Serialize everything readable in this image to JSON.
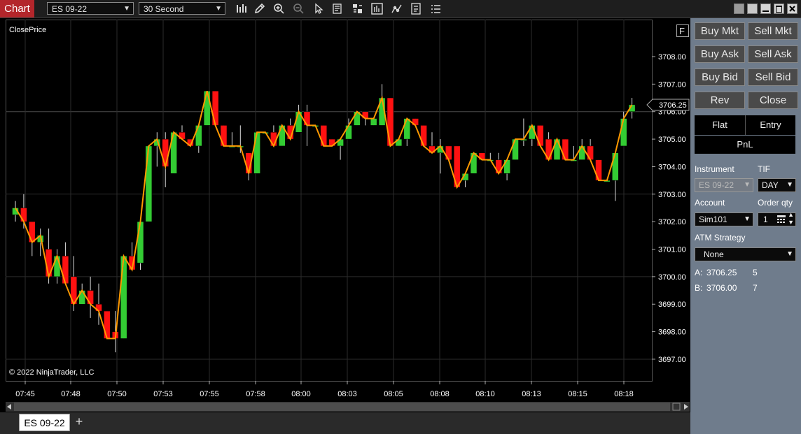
{
  "app": {
    "title": "Chart",
    "accent": "#b3262b"
  },
  "toolbar": {
    "instrument": "ES 09-22",
    "interval": "30 Second",
    "icons": [
      "bar-type-icon",
      "pencil-icon",
      "zoom-in-icon",
      "zoom-out-icon",
      "pointer-icon",
      "properties-icon",
      "data-box-icon",
      "indicators-icon",
      "strategies-icon",
      "chart-trader-icon",
      "more-icon"
    ]
  },
  "chart": {
    "plot_label": "ClosePrice",
    "f_button": "F",
    "copyright": "© 2022 NinjaTrader, LLC",
    "price_marker": "3706.25"
  },
  "chart_data": {
    "type": "candlestick",
    "x_ticks": [
      "07:45",
      "07:48",
      "07:50",
      "07:53",
      "07:55",
      "07:58",
      "08:00",
      "08:03",
      "08:05",
      "08:08",
      "08:10",
      "08:13",
      "08:15",
      "08:18"
    ],
    "y_ticks": [
      "3708.00",
      "3707.00",
      "3706.00",
      "3705.00",
      "3704.00",
      "3703.00",
      "3702.00",
      "3701.00",
      "3700.00",
      "3699.00",
      "3698.00",
      "3697.00"
    ],
    "ylim": [
      3696.7,
      3708.6
    ],
    "up_color": "#33cc33",
    "down_color": "#ff1111",
    "line_color": "#ff9900",
    "bars": [
      {
        "o": 3702.25,
        "h": 3702.75,
        "l": 3702.0,
        "c": 3702.5
      },
      {
        "o": 3702.5,
        "h": 3703.0,
        "l": 3701.75,
        "c": 3702.0
      },
      {
        "o": 3702.0,
        "h": 3702.0,
        "l": 3700.75,
        "c": 3701.25
      },
      {
        "o": 3701.25,
        "h": 3701.75,
        "l": 3700.75,
        "c": 3701.5
      },
      {
        "o": 3701.0,
        "h": 3701.75,
        "l": 3699.75,
        "c": 3700.0
      },
      {
        "o": 3700.0,
        "h": 3701.0,
        "l": 3699.75,
        "c": 3700.75
      },
      {
        "o": 3700.75,
        "h": 3701.25,
        "l": 3699.75,
        "c": 3699.75
      },
      {
        "o": 3700.0,
        "h": 3700.75,
        "l": 3698.75,
        "c": 3699.0
      },
      {
        "o": 3699.0,
        "h": 3699.75,
        "l": 3699.0,
        "c": 3699.5
      },
      {
        "o": 3699.5,
        "h": 3700.0,
        "l": 3698.5,
        "c": 3699.0
      },
      {
        "o": 3699.0,
        "h": 3699.75,
        "l": 3698.25,
        "c": 3698.75
      },
      {
        "o": 3698.75,
        "h": 3698.75,
        "l": 3697.75,
        "c": 3697.75
      },
      {
        "o": 3698.0,
        "h": 3698.75,
        "l": 3697.25,
        "c": 3697.75
      },
      {
        "o": 3697.75,
        "h": 3700.75,
        "l": 3697.75,
        "c": 3700.75
      },
      {
        "o": 3700.75,
        "h": 3701.25,
        "l": 3700.25,
        "c": 3700.25
      },
      {
        "o": 3700.5,
        "h": 3701.25,
        "l": 3700.25,
        "c": 3702.0
      },
      {
        "o": 3702.0,
        "h": 3704.75,
        "l": 3702.0,
        "c": 3704.75
      },
      {
        "o": 3704.75,
        "h": 3705.25,
        "l": 3704.0,
        "c": 3705.0
      },
      {
        "o": 3705.0,
        "h": 3705.25,
        "l": 3703.25,
        "c": 3704.0
      },
      {
        "o": 3703.75,
        "h": 3705.25,
        "l": 3703.75,
        "c": 3705.25
      },
      {
        "o": 3705.25,
        "h": 3705.5,
        "l": 3705.0,
        "c": 3705.0
      },
      {
        "o": 3705.0,
        "h": 3705.0,
        "l": 3704.75,
        "c": 3704.75
      },
      {
        "o": 3704.75,
        "h": 3705.5,
        "l": 3704.5,
        "c": 3705.5
      },
      {
        "o": 3705.5,
        "h": 3706.75,
        "l": 3705.5,
        "c": 3706.75
      },
      {
        "o": 3706.75,
        "h": 3706.75,
        "l": 3705.5,
        "c": 3705.5
      },
      {
        "o": 3705.5,
        "h": 3705.5,
        "l": 3704.75,
        "c": 3704.75
      },
      {
        "o": 3704.75,
        "h": 3705.25,
        "l": 3704.75,
        "c": 3704.75
      },
      {
        "o": 3704.75,
        "h": 3705.5,
        "l": 3704.5,
        "c": 3704.75
      },
      {
        "o": 3704.5,
        "h": 3704.5,
        "l": 3703.5,
        "c": 3703.75
      },
      {
        "o": 3703.75,
        "h": 3705.25,
        "l": 3703.75,
        "c": 3705.25
      },
      {
        "o": 3705.25,
        "h": 3705.25,
        "l": 3705.25,
        "c": 3705.25
      },
      {
        "o": 3705.25,
        "h": 3705.5,
        "l": 3704.75,
        "c": 3704.75
      },
      {
        "o": 3704.75,
        "h": 3705.5,
        "l": 3704.75,
        "c": 3705.5
      },
      {
        "o": 3705.5,
        "h": 3705.75,
        "l": 3705.0,
        "c": 3705.0
      },
      {
        "o": 3705.25,
        "h": 3706.25,
        "l": 3705.25,
        "c": 3706.0
      },
      {
        "o": 3706.0,
        "h": 3706.25,
        "l": 3704.75,
        "c": 3705.5
      },
      {
        "o": 3705.5,
        "h": 3705.5,
        "l": 3705.5,
        "c": 3705.5
      },
      {
        "o": 3705.5,
        "h": 3705.5,
        "l": 3704.75,
        "c": 3704.75
      },
      {
        "o": 3705.0,
        "h": 3705.0,
        "l": 3704.75,
        "c": 3704.75
      },
      {
        "o": 3704.75,
        "h": 3705.0,
        "l": 3704.25,
        "c": 3705.0
      },
      {
        "o": 3705.0,
        "h": 3705.75,
        "l": 3705.0,
        "c": 3705.5
      },
      {
        "o": 3705.5,
        "h": 3705.75,
        "l": 3705.5,
        "c": 3706.0
      },
      {
        "o": 3706.0,
        "h": 3706.0,
        "l": 3705.5,
        "c": 3705.75
      },
      {
        "o": 3705.5,
        "h": 3705.75,
        "l": 3705.5,
        "c": 3705.75
      },
      {
        "o": 3705.5,
        "h": 3707.0,
        "l": 3705.5,
        "c": 3706.5
      },
      {
        "o": 3706.5,
        "h": 3706.5,
        "l": 3704.75,
        "c": 3704.75
      },
      {
        "o": 3704.75,
        "h": 3705.0,
        "l": 3704.75,
        "c": 3705.0
      },
      {
        "o": 3705.0,
        "h": 3705.75,
        "l": 3704.75,
        "c": 3705.75
      },
      {
        "o": 3705.75,
        "h": 3705.75,
        "l": 3705.5,
        "c": 3705.5
      },
      {
        "o": 3705.5,
        "h": 3705.5,
        "l": 3704.75,
        "c": 3704.75
      },
      {
        "o": 3704.75,
        "h": 3705.25,
        "l": 3704.5,
        "c": 3704.5
      },
      {
        "o": 3704.5,
        "h": 3705.0,
        "l": 3703.75,
        "c": 3704.75
      },
      {
        "o": 3704.75,
        "h": 3704.75,
        "l": 3704.25,
        "c": 3704.25
      },
      {
        "o": 3704.75,
        "h": 3704.75,
        "l": 3703.25,
        "c": 3703.25
      },
      {
        "o": 3703.5,
        "h": 3703.75,
        "l": 3703.25,
        "c": 3703.75
      },
      {
        "o": 3703.75,
        "h": 3704.5,
        "l": 3703.75,
        "c": 3704.5
      },
      {
        "o": 3704.5,
        "h": 3704.5,
        "l": 3704.25,
        "c": 3704.25
      },
      {
        "o": 3704.25,
        "h": 3704.5,
        "l": 3704.25,
        "c": 3704.25
      },
      {
        "o": 3704.25,
        "h": 3704.5,
        "l": 3703.75,
        "c": 3703.75
      },
      {
        "o": 3703.75,
        "h": 3704.25,
        "l": 3703.5,
        "c": 3704.25
      },
      {
        "o": 3704.25,
        "h": 3705.0,
        "l": 3704.25,
        "c": 3705.0
      },
      {
        "o": 3705.0,
        "h": 3705.75,
        "l": 3704.75,
        "c": 3705.0
      },
      {
        "o": 3705.0,
        "h": 3705.5,
        "l": 3704.75,
        "c": 3705.5
      },
      {
        "o": 3705.5,
        "h": 3705.5,
        "l": 3704.75,
        "c": 3704.75
      },
      {
        "o": 3705.0,
        "h": 3705.25,
        "l": 3704.25,
        "c": 3704.25
      },
      {
        "o": 3704.25,
        "h": 3705.0,
        "l": 3704.25,
        "c": 3705.0
      },
      {
        "o": 3705.0,
        "h": 3705.0,
        "l": 3704.25,
        "c": 3704.25
      },
      {
        "o": 3704.25,
        "h": 3704.75,
        "l": 3704.25,
        "c": 3704.25
      },
      {
        "o": 3704.25,
        "h": 3705.0,
        "l": 3704.25,
        "c": 3704.75
      },
      {
        "o": 3704.75,
        "h": 3705.0,
        "l": 3704.25,
        "c": 3704.25
      },
      {
        "o": 3704.25,
        "h": 3704.25,
        "l": 3703.5,
        "c": 3703.5
      },
      {
        "o": 3703.5,
        "h": 3703.5,
        "l": 3703.5,
        "c": 3703.5
      },
      {
        "o": 3703.5,
        "h": 3704.5,
        "l": 3702.75,
        "c": 3704.5
      },
      {
        "o": 3704.75,
        "h": 3706.0,
        "l": 3704.75,
        "c": 3705.75
      },
      {
        "o": 3706.0,
        "h": 3706.5,
        "l": 3705.75,
        "c": 3706.25
      }
    ]
  },
  "side_panel": {
    "buttons": [
      [
        "Buy Mkt",
        "Sell Mkt"
      ],
      [
        "Buy Ask",
        "Sell Ask"
      ],
      [
        "Buy Bid",
        "Sell Bid"
      ],
      [
        "Rev",
        "Close"
      ]
    ],
    "pos_headers": [
      "Flat",
      "Entry"
    ],
    "pnl_label": "PnL",
    "instrument_label": "Instrument",
    "instrument_value": "ES 09-22",
    "tif_label": "TIF",
    "tif_value": "DAY",
    "account_label": "Account",
    "account_value": "Sim101",
    "qty_label": "Order qty",
    "qty_value": "1",
    "atm_label": "ATM Strategy",
    "atm_value": "None",
    "ask_label": "A:",
    "ask_price": "3706.25",
    "ask_size": "5",
    "bid_label": "B:",
    "bid_price": "3706.00",
    "bid_size": "7"
  },
  "tabs": {
    "active": "ES 09-22",
    "add": "+"
  }
}
